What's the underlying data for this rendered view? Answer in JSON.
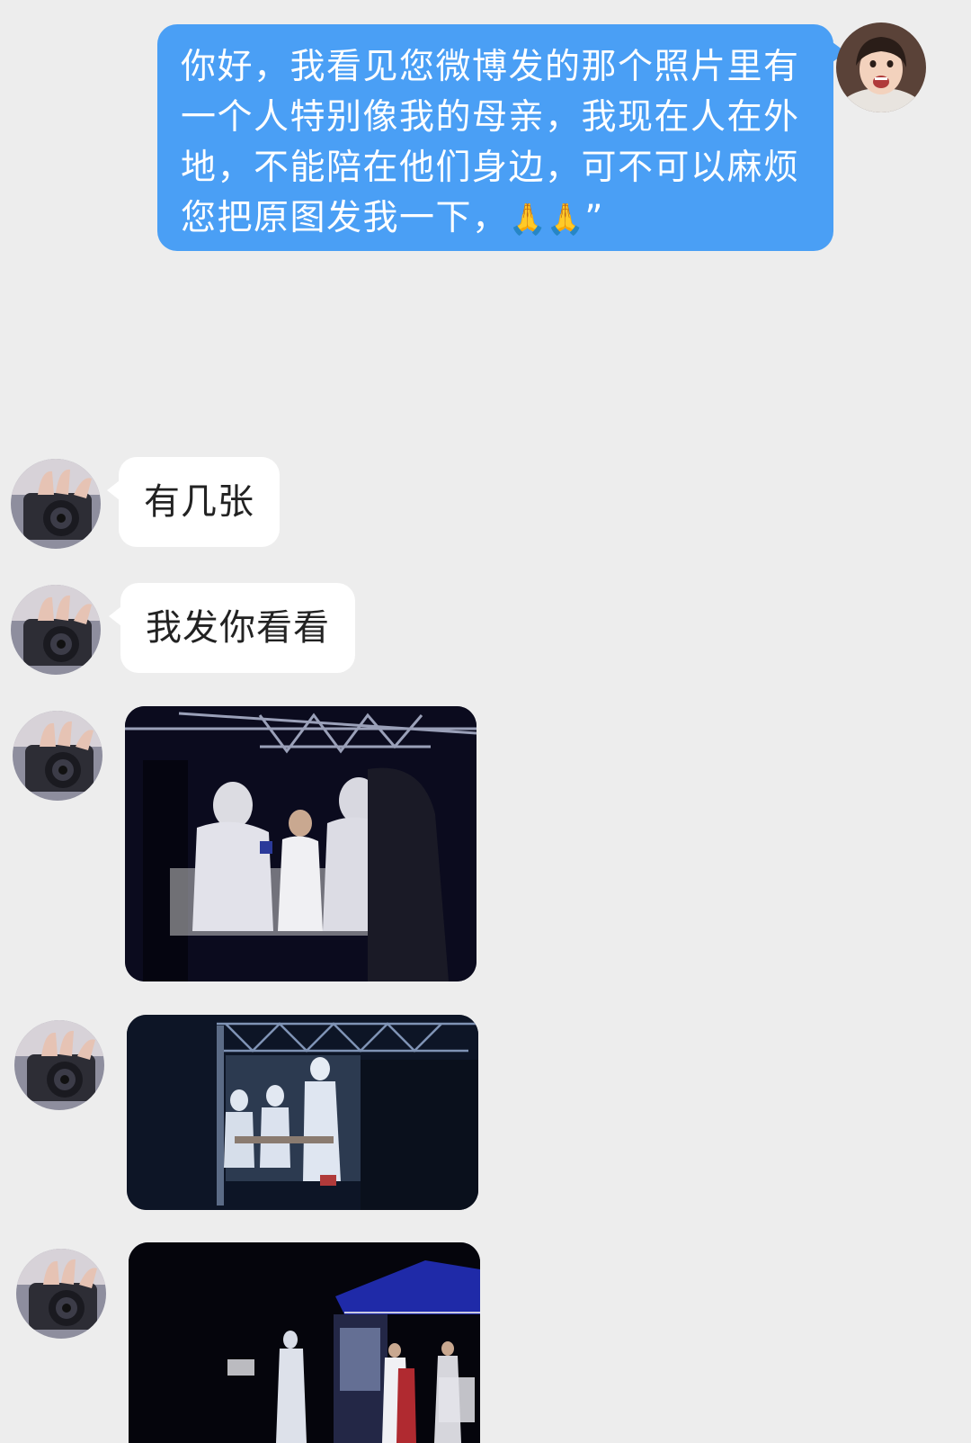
{
  "conversation": {
    "outgoing": {
      "lines": [
        "你好，我看见您微博发的那个照片里有",
        "一个人特别像我的母亲，我现在人在外",
        "地，不能陪在他们身边，可不可以麻烦",
        "您把原图发我一下，"
      ],
      "emoji": "🙏🙏",
      "closing_quote": "”"
    },
    "incoming": [
      {
        "type": "text",
        "text": "有几张"
      },
      {
        "type": "text",
        "text": "我发你看看"
      },
      {
        "type": "image",
        "icon": "night-medical-workers-photo"
      },
      {
        "type": "image",
        "icon": "night-testing-tent-photo"
      },
      {
        "type": "image",
        "icon": "night-blue-tent-photo"
      }
    ]
  },
  "avatars": {
    "self": "smiling-girl-avatar",
    "contact": "camera-photographer-avatar"
  },
  "colors": {
    "background": "#ededed",
    "outgoing_bubble": "#4a9ff5",
    "incoming_bubble": "#ffffff"
  }
}
